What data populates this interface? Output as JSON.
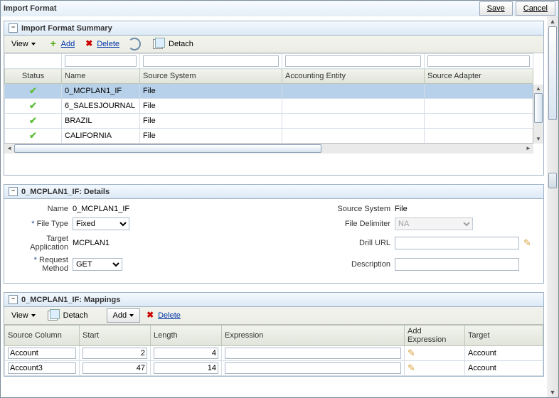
{
  "title": "Import Format",
  "buttons": {
    "save": "Save",
    "cancel": "Cancel"
  },
  "summary": {
    "title": "Import Format Summary",
    "toolbar": {
      "view": "View",
      "add": "Add",
      "delete": "Delete",
      "detach": "Detach"
    },
    "columns": {
      "status": "Status",
      "name": "Name",
      "source_system": "Source System",
      "accounting_entity": "Accounting Entity",
      "source_adapter": "Source Adapter"
    },
    "rows": [
      {
        "status": "ok",
        "name": "0_MCPLAN1_IF",
        "source_system": "File",
        "accounting_entity": "",
        "source_adapter": ""
      },
      {
        "status": "ok",
        "name": "6_SALESJOURNAL",
        "source_system": "File",
        "accounting_entity": "",
        "source_adapter": ""
      },
      {
        "status": "ok",
        "name": "BRAZIL",
        "source_system": "File",
        "accounting_entity": "",
        "source_adapter": ""
      },
      {
        "status": "ok",
        "name": "CALIFORNIA",
        "source_system": "File",
        "accounting_entity": "",
        "source_adapter": ""
      }
    ]
  },
  "details": {
    "title": "0_MCPLAN1_IF: Details",
    "labels": {
      "name": "Name",
      "file_type": "File Type",
      "target_app": "Target Application",
      "request_method": "Request Method",
      "source_system": "Source System",
      "file_delimiter": "File Delimiter",
      "drill_url": "Drill URL",
      "description": "Description"
    },
    "values": {
      "name": "0_MCPLAN1_IF",
      "file_type": "Fixed",
      "target_app": "MCPLAN1",
      "request_method": "GET",
      "source_system": "File",
      "file_delimiter": "NA",
      "drill_url": "",
      "description": ""
    }
  },
  "mappings": {
    "title": "0_MCPLAN1_IF: Mappings",
    "toolbar": {
      "view": "View",
      "detach": "Detach",
      "add": "Add",
      "delete": "Delete"
    },
    "columns": {
      "source_column": "Source Column",
      "start": "Start",
      "length": "Length",
      "expression": "Expression",
      "add_expression": "Add Expression",
      "target": "Target"
    },
    "rows": [
      {
        "source_column": "Account",
        "start": "2",
        "length": "4",
        "expression": "",
        "target": "Account"
      },
      {
        "source_column": "Account3",
        "start": "47",
        "length": "14",
        "expression": "",
        "target": "Account"
      }
    ]
  }
}
